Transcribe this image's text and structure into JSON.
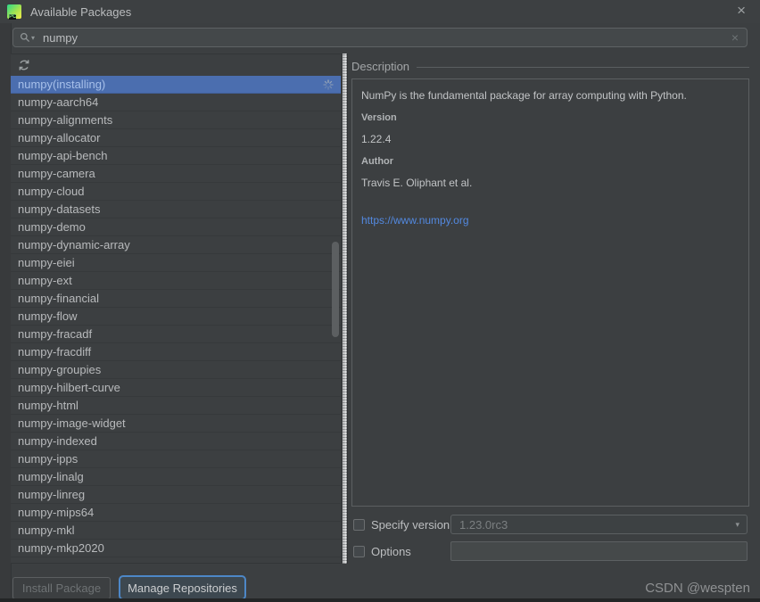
{
  "window": {
    "title": "Available Packages",
    "close_glyph": "×"
  },
  "search": {
    "query": "numpy",
    "clear_glyph": "×",
    "history_chevron_glyph": "▾"
  },
  "package_list": {
    "selected_label": "numpy(installing)",
    "items": [
      "numpy-aarch64",
      "numpy-alignments",
      "numpy-allocator",
      "numpy-api-bench",
      "numpy-camera",
      "numpy-cloud",
      "numpy-datasets",
      "numpy-demo",
      "numpy-dynamic-array",
      "numpy-eiei",
      "numpy-ext",
      "numpy-financial",
      "numpy-flow",
      "numpy-fracadf",
      "numpy-fracdiff",
      "numpy-groupies",
      "numpy-hilbert-curve",
      "numpy-html",
      "numpy-image-widget",
      "numpy-indexed",
      "numpy-ipps",
      "numpy-linalg",
      "numpy-linreg",
      "numpy-mips64",
      "numpy-mkl",
      "numpy-mkp2020"
    ]
  },
  "description_panel": {
    "section_title": "Description",
    "summary": "NumPy is the fundamental package for array computing with Python.",
    "version_label": "Version",
    "version_value": "1.22.4",
    "author_label": "Author",
    "author_value": "Travis E. Oliphant et al.",
    "link": "https://www.numpy.org"
  },
  "version_form": {
    "specify_version_label": "Specify version",
    "specify_version_value": "1.23.0rc3",
    "combo_arrow_glyph": "▾",
    "options_label": "Options",
    "options_value": ""
  },
  "footer": {
    "install_button": "Install Package",
    "manage_button": "Manage Repositories",
    "watermark": "CSDN @wespten"
  },
  "colors": {
    "background": "#3c3f41",
    "selection_bg": "#4b6eaf",
    "selection_text": "#a7c0ea",
    "link": "#5389e0",
    "focus_border": "#4d87c7",
    "text": "#b8babc"
  }
}
